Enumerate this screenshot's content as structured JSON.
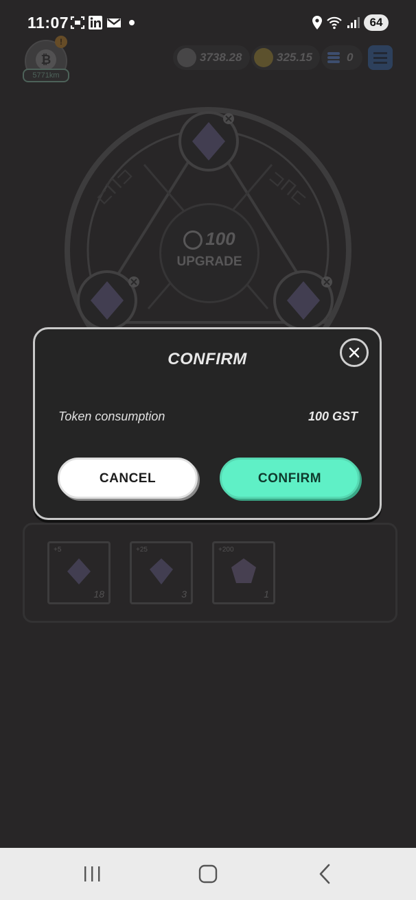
{
  "status_bar": {
    "time": "11:07",
    "battery": "64",
    "left_icons": [
      "screenshot-icon",
      "linkedin-icon",
      "gmail-icon",
      "dot-icon"
    ],
    "right_icons": [
      "location-icon",
      "wifi-icon",
      "signal-icon"
    ]
  },
  "game": {
    "distance": "5771km",
    "alert_badge": "!",
    "balances": {
      "gst": "3738.28",
      "gmt": "325.15",
      "stack": "0"
    },
    "upgrade": {
      "amount": "100",
      "label": "UPGRADE"
    },
    "inventory": [
      {
        "bonus": "+5",
        "count": "18"
      },
      {
        "bonus": "+25",
        "count": "3"
      },
      {
        "bonus": "+200",
        "count": "1"
      }
    ]
  },
  "dialog": {
    "title": "CONFIRM",
    "row_label": "Token consumption",
    "row_value": "100 GST",
    "cancel_label": "CANCEL",
    "confirm_label": "CONFIRM"
  },
  "colors": {
    "accent": "#5ff0c6",
    "background": "#282627",
    "dialog_bg": "#252525"
  }
}
